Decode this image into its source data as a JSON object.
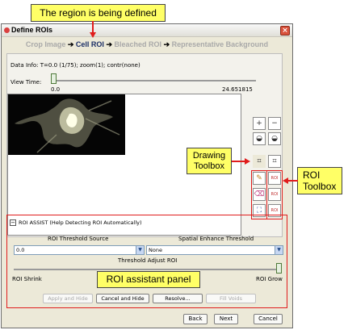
{
  "window": {
    "title": "Define ROIs",
    "close_glyph": "×"
  },
  "steps": [
    {
      "label": "Crop Image",
      "active": false
    },
    {
      "label": "Cell ROI",
      "active": true
    },
    {
      "label": "Bleached ROI",
      "active": false
    },
    {
      "label": "Representative Background",
      "active": false
    }
  ],
  "step_separator": "➔",
  "data_info": {
    "label": "Data Info:",
    "value": "T=0.0  (1/75); zoom(1); contr(none)"
  },
  "view_time": {
    "label": "View Time:",
    "min": "0.0",
    "max": "24.651815",
    "value_fraction": 0.0
  },
  "tools": {
    "zoom_in": "+",
    "zoom_out": "−",
    "fill_up": "◒",
    "fill_down": "◒",
    "crop": "⌗",
    "crop_alt": "⌗",
    "pencil": "✎",
    "roi_a": "ROI",
    "eraser": "⌫",
    "roi_b": "ROI",
    "fill": "⛶",
    "roi_c": "ROI"
  },
  "roi_assist": {
    "toggle": "−",
    "title": "ROI ASSIST (Help Detecting ROI Automatically)",
    "threshold_source_label": "ROI Threshold Source",
    "threshold_source_value": "0.0",
    "spatial_label": "Spatial Enhance Threshold",
    "spatial_value": "None",
    "adjust_label": "Threshold Adjust ROI",
    "shrink_label": "ROI Shrink",
    "grow_label": "ROI Grow",
    "slider_fraction": 1.0,
    "buttons": {
      "apply_hide": "Apply and Hide",
      "cancel_hide": "Cancel and Hide",
      "resolve": "Resolve...",
      "fill_voids": "Fill Voids"
    }
  },
  "footer": {
    "back": "Back",
    "next": "Next",
    "cancel": "Cancel"
  },
  "annotations": {
    "region": "The region is being defined",
    "drawing_toolbox": "Drawing Toolbox",
    "roi_toolbox": "ROI Toolbox",
    "assistant_panel": "ROI assistant panel"
  },
  "colors": {
    "annotation_red": "#e01c1c",
    "callout_yellow": "#ffff66",
    "window_bg": "#ece9d8",
    "active_step": "#1b2e66"
  }
}
